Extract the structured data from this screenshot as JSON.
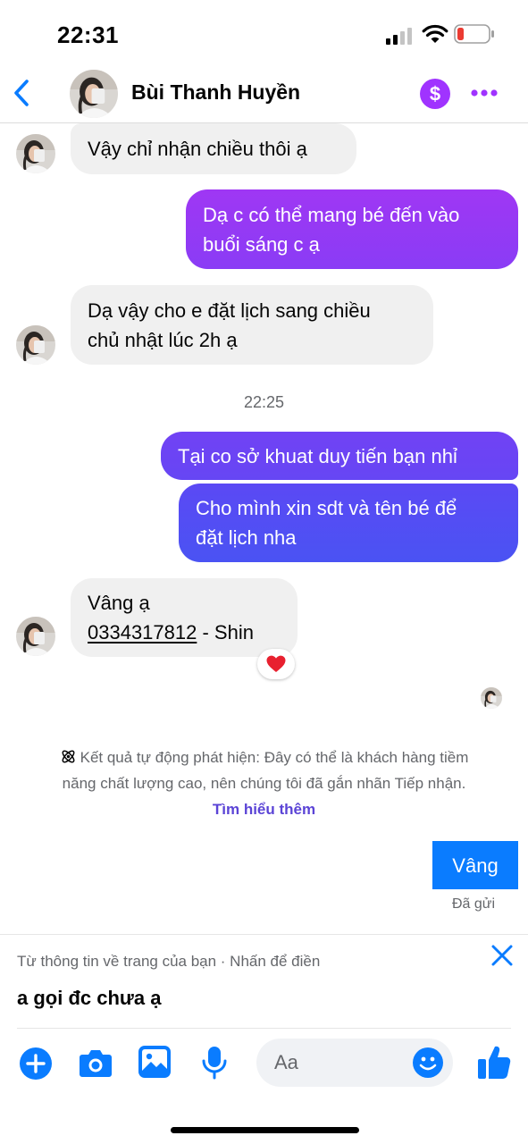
{
  "status_bar": {
    "time": "22:31"
  },
  "header": {
    "contact_name": "Bùi Thanh Huyền"
  },
  "messages": [
    {
      "lines": [
        "Vậy chỉ nhận chiều thôi ạ"
      ]
    },
    {
      "lines": [
        "Dạ c có thể mang bé đến vào",
        "buổi sáng c ạ"
      ]
    },
    {
      "lines": [
        "Dạ vậy cho e đặt lịch sang chiều",
        "chủ nhật lúc 2h ạ"
      ]
    },
    {
      "lines": [
        "Tại co sở khuat duy tiến bạn nhỉ"
      ]
    },
    {
      "lines": [
        "Cho mình xin sdt và tên bé để",
        "đặt lịch nha"
      ]
    },
    {
      "lines": [
        "Vâng ạ"
      ],
      "phone": "0334317812",
      "suffix": " - Shin"
    },
    {
      "lines": [
        "Vâng"
      ]
    }
  ],
  "timestamp": "22:25",
  "reaction": "heart",
  "notice": {
    "line1": "Kết quả tự động phát hiện: Đây có thể là khách hàng tiềm",
    "line2": "năng chất lượng cao, nên chúng tôi đã gắn nhãn Tiếp nhận.",
    "link": "Tìm hiểu thêm"
  },
  "sent_status": "Đã gửi",
  "suggestion": {
    "label": "Từ thông tin về trang của bạn · Nhấn để điền",
    "text": "a gọi đc chưa ạ"
  },
  "composer": {
    "placeholder": "Aa"
  },
  "colors": {
    "accent_blue": "#0a7cff",
    "accent_purple": "#a033ff",
    "incoming_bubble": "#f0f0f0",
    "outgoing_gradient_top": "#9b36f5",
    "outgoing_gradient_bottom": "#4257f3",
    "link_purple": "#5b44d6"
  }
}
